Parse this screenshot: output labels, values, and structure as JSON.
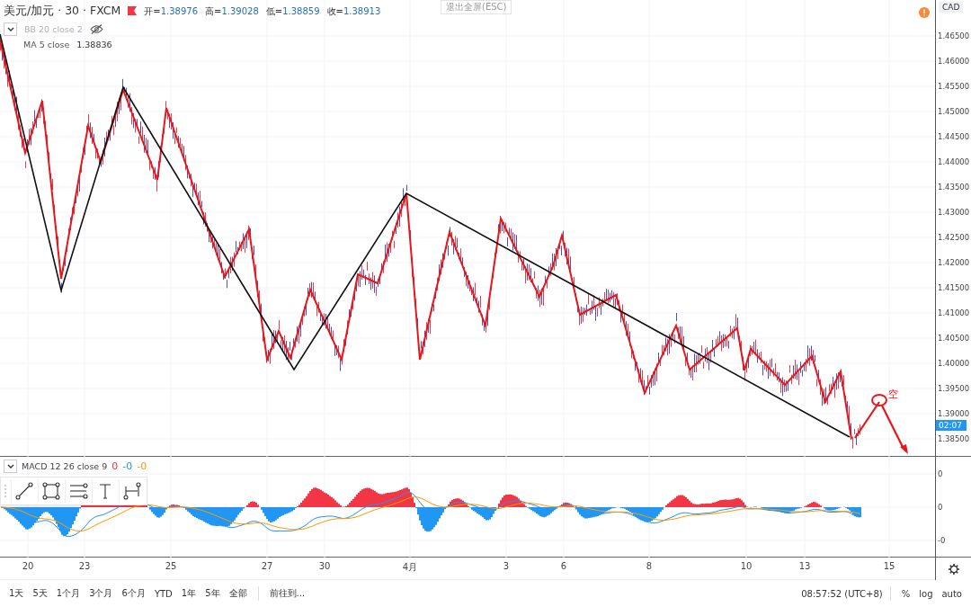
{
  "header": {
    "symbol": "美元/加元 · 30 · FXCM",
    "ohlc": [
      {
        "label": "开=",
        "value": "1.38976"
      },
      {
        "label": "高=",
        "value": "1.39028"
      },
      {
        "label": "低=",
        "value": "1.38859"
      },
      {
        "label": "收=",
        "value": "1.38913"
      }
    ]
  },
  "bb": {
    "label": "BB 20 close 2",
    "visible": false
  },
  "ma": {
    "label": "MA 5 close",
    "value": "1.38836"
  },
  "exit_fullscreen": "退出全屏(ESC)",
  "currency": "CAD",
  "price_axis_labels": [
    "1.46500",
    "1.46000",
    "1.45500",
    "1.45000",
    "1.44500",
    "1.44000",
    "1.43500",
    "1.43000",
    "1.42500",
    "1.42000",
    "1.41500",
    "1.41000",
    "1.40500",
    "1.40000",
    "1.39500",
    "1.39000",
    "1.38500"
  ],
  "last_price_label": "02:07",
  "annotation": "空",
  "time_axis_labels": [
    "20",
    "23",
    "25",
    "27",
    "30",
    "4月",
    "3",
    "6",
    "8",
    "10",
    "13",
    "15"
  ],
  "macd": {
    "label": "MACD 12 26 close 9",
    "values": [
      {
        "text": "0",
        "color": "#f23645"
      },
      {
        "text": "-0",
        "color": "#2196f3"
      },
      {
        "text": "-0",
        "color": "#ff9800"
      }
    ],
    "axis_labels": [
      "0",
      "0",
      "-0"
    ]
  },
  "drawing_tools": [
    {
      "kind": "trend-line"
    },
    {
      "kind": "rectangle"
    },
    {
      "kind": "channel"
    },
    {
      "kind": "text"
    },
    {
      "kind": "range"
    }
  ],
  "ranges": [
    "1天",
    "5天",
    "1个月",
    "3个月",
    "6个月",
    "YTD",
    "1年",
    "5年",
    "全部"
  ],
  "goto": "前往到...",
  "clock": "08:57:52 (UTC+8)",
  "scale_options": [
    "%",
    "log",
    "auto"
  ]
}
